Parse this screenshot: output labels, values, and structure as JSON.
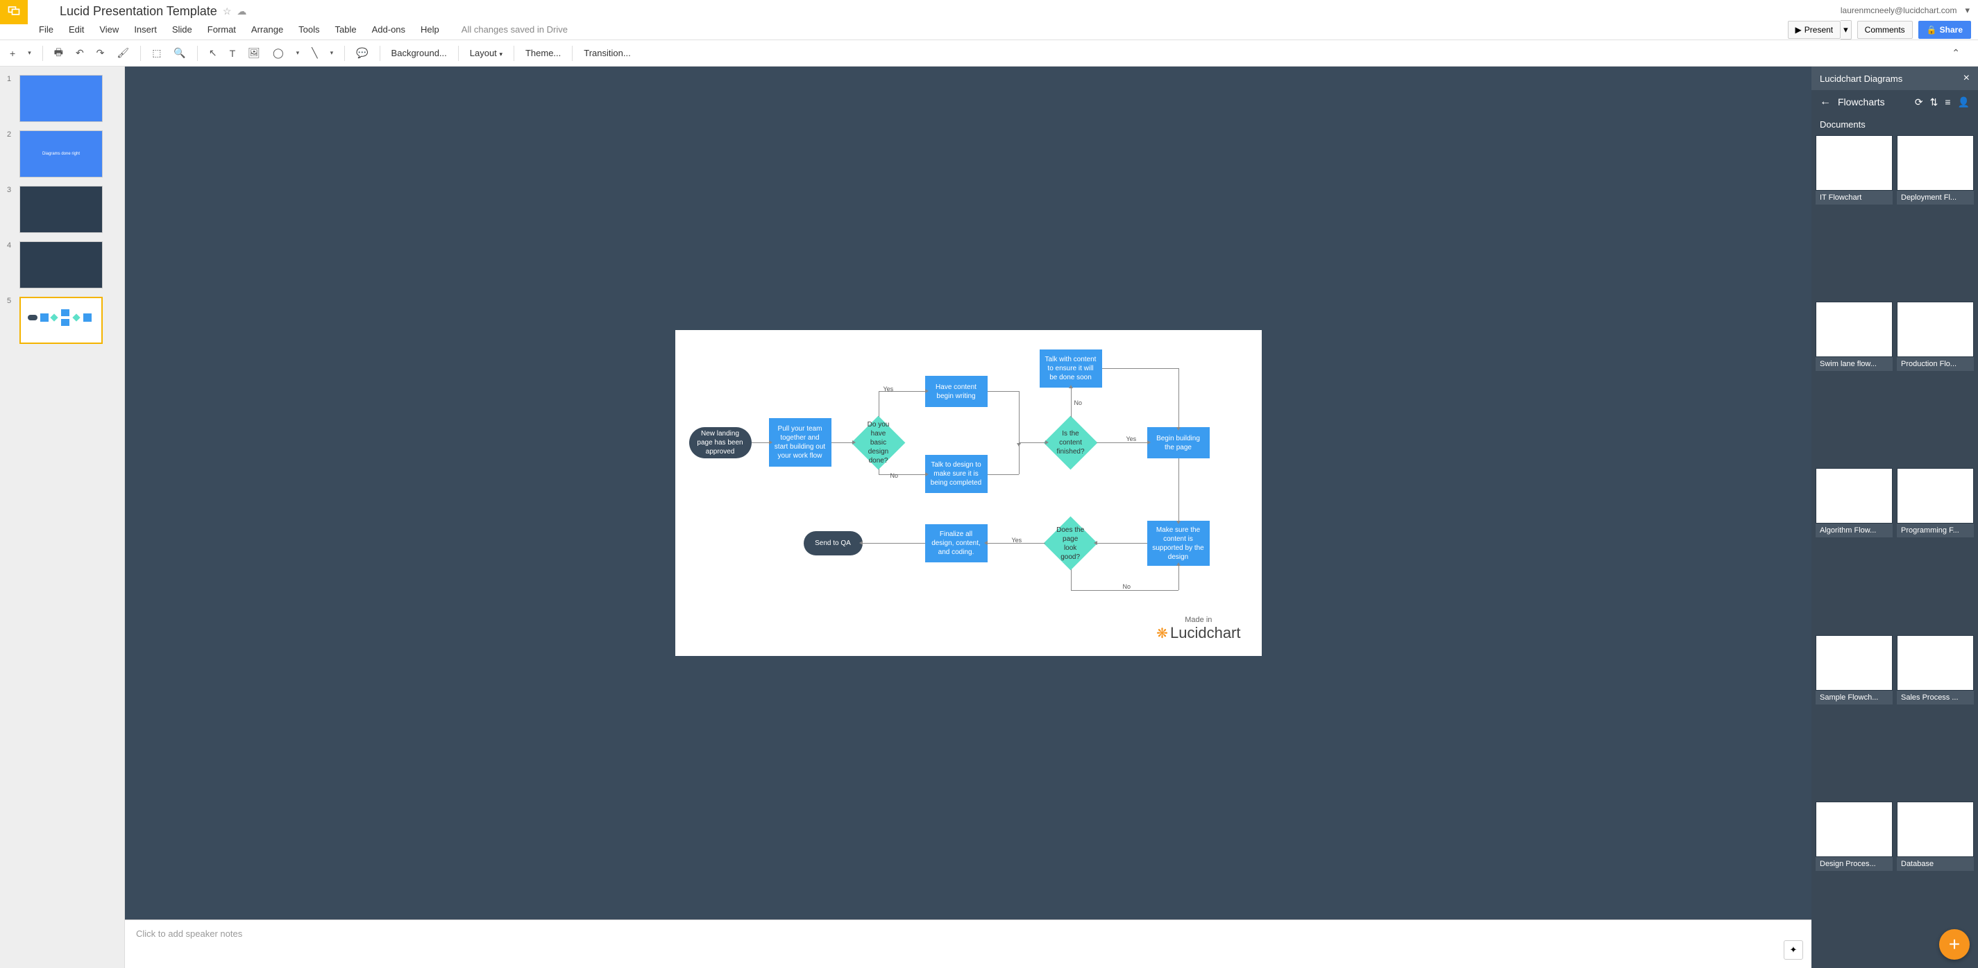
{
  "header": {
    "doc_title": "Lucid Presentation Template",
    "user_email": "laurenmcneely@lucidchart.com",
    "present_label": "Present",
    "comments_label": "Comments",
    "share_label": "Share"
  },
  "menu": {
    "file": "File",
    "edit": "Edit",
    "view": "View",
    "insert": "Insert",
    "slide": "Slide",
    "format": "Format",
    "arrange": "Arrange",
    "tools": "Tools",
    "table": "Table",
    "add_ons": "Add-ons",
    "help": "Help",
    "save_status": "All changes saved in Drive"
  },
  "toolbar": {
    "background": "Background...",
    "layout": "Layout",
    "theme": "Theme...",
    "transition": "Transition..."
  },
  "slides": [
    {
      "num": "1"
    },
    {
      "num": "2"
    },
    {
      "num": "3"
    },
    {
      "num": "4"
    },
    {
      "num": "5"
    }
  ],
  "flowchart": {
    "made_in": "Made in",
    "brand": "Lucidchart",
    "shapes": {
      "start": "New landing page has been approved",
      "pull_team": "Pull your team together and start building out your work flow",
      "design_done": "Do you have basic design done?",
      "have_content": "Have content begin writing",
      "talk_design": "Talk to design to make sure it is being completed",
      "talk_content": "Talk with content to ensure it will be done soon",
      "content_finished": "Is the content finished?",
      "begin_build": "Begin building the page",
      "make_sure": "Make sure the content is supported by the design",
      "look_good": "Does the page look good?",
      "finalize": "Finalize all design, content, and coding.",
      "send_qa": "Send to QA"
    },
    "labels": {
      "yes": "Yes",
      "no": "No"
    }
  },
  "speaker_notes_placeholder": "Click to add speaker notes",
  "sidebar": {
    "title": "Lucidchart Diagrams",
    "nav_title": "Flowcharts",
    "section": "Documents",
    "docs": [
      {
        "label": "IT Flowchart"
      },
      {
        "label": "Deployment Fl..."
      },
      {
        "label": "Swim lane flow..."
      },
      {
        "label": "Production Flo..."
      },
      {
        "label": "Algorithm Flow..."
      },
      {
        "label": "Programming F..."
      },
      {
        "label": "Sample Flowch..."
      },
      {
        "label": "Sales Process ..."
      },
      {
        "label": "Design Proces..."
      },
      {
        "label": "Database"
      }
    ]
  }
}
